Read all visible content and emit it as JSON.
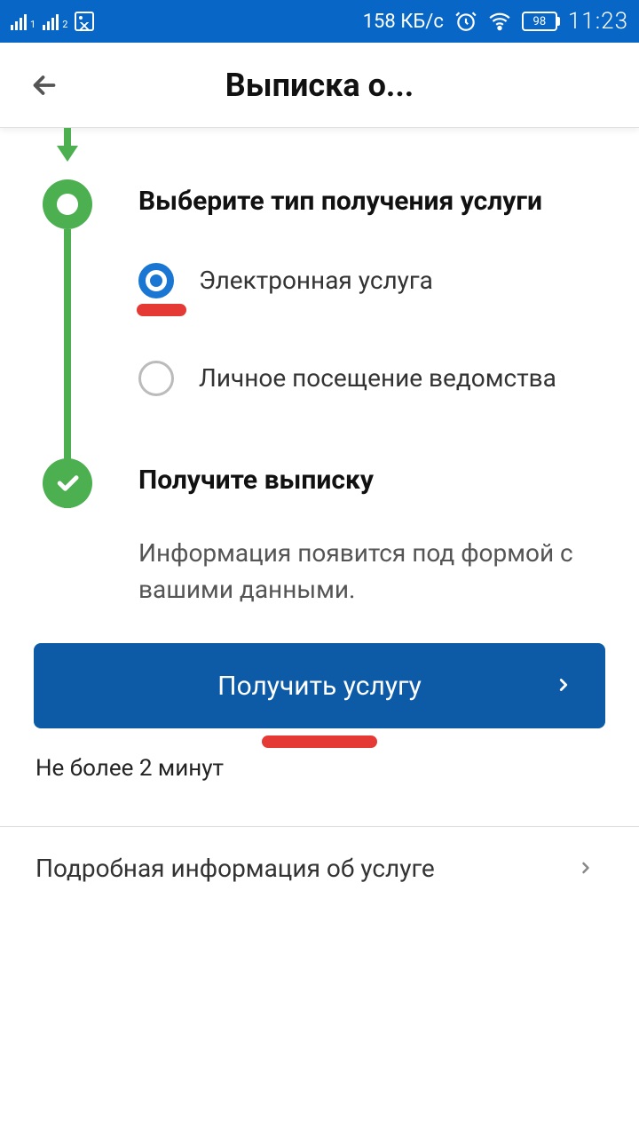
{
  "status": {
    "speed": "158 КБ/с",
    "battery": "98",
    "time": "11:23"
  },
  "header": {
    "title": "Выписка о..."
  },
  "steps": {
    "choose": {
      "title": "Выберите тип получения услуги",
      "option_electronic": "Электронная услуга",
      "option_in_person": "Личное посещение ведомства"
    },
    "receive": {
      "title": "Получите выписку",
      "description": "Информация появится под формой с вашими данными."
    }
  },
  "cta": {
    "label": "Получить услугу"
  },
  "wait_note": "Не более 2 минут",
  "more_info": "Подробная информация об услуге"
}
